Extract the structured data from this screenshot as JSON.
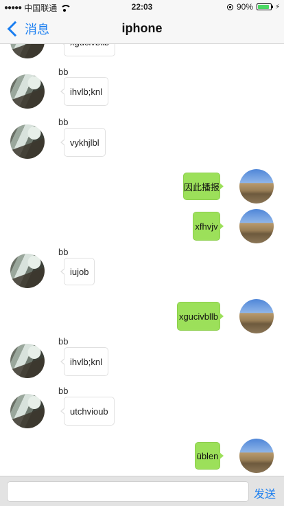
{
  "status_bar": {
    "signal": "●●●●●",
    "carrier": "中国联通",
    "time": "22:03",
    "battery": "90%",
    "battery_level": 0.9,
    "battery_color": "#4cd964"
  },
  "nav": {
    "back_label": "消息",
    "title": "iphone",
    "accent_color": "#1a7ef0"
  },
  "messages": [
    {
      "side": "them",
      "sender": "",
      "text": "xgucivbllb"
    },
    {
      "side": "them",
      "sender": "bb",
      "text": "ihvlb;knl"
    },
    {
      "side": "them",
      "sender": "bb",
      "text": "vykhjlbl"
    },
    {
      "side": "me",
      "text": "因此播报"
    },
    {
      "side": "me",
      "text": "xfhvjv"
    },
    {
      "side": "them",
      "sender": "bb",
      "text": "iujob"
    },
    {
      "side": "me",
      "text": "xgucivbllb"
    },
    {
      "side": "them",
      "sender": "bb",
      "text": "ihvlb;knl"
    },
    {
      "side": "them",
      "sender": "bb",
      "text": "utchvioub"
    },
    {
      "side": "me",
      "text": "üblen"
    }
  ],
  "input_bar": {
    "placeholder": "",
    "value": "",
    "send_label": "发送"
  },
  "colors": {
    "my_bubble": "#9ce05a",
    "their_bubble": "#ffffff"
  },
  "icons": {
    "back": "chevron-left-icon",
    "wifi": "wifi-icon",
    "lock": "rotation-lock-icon",
    "battery": "battery-icon",
    "charging": "charging-bolt-icon"
  }
}
